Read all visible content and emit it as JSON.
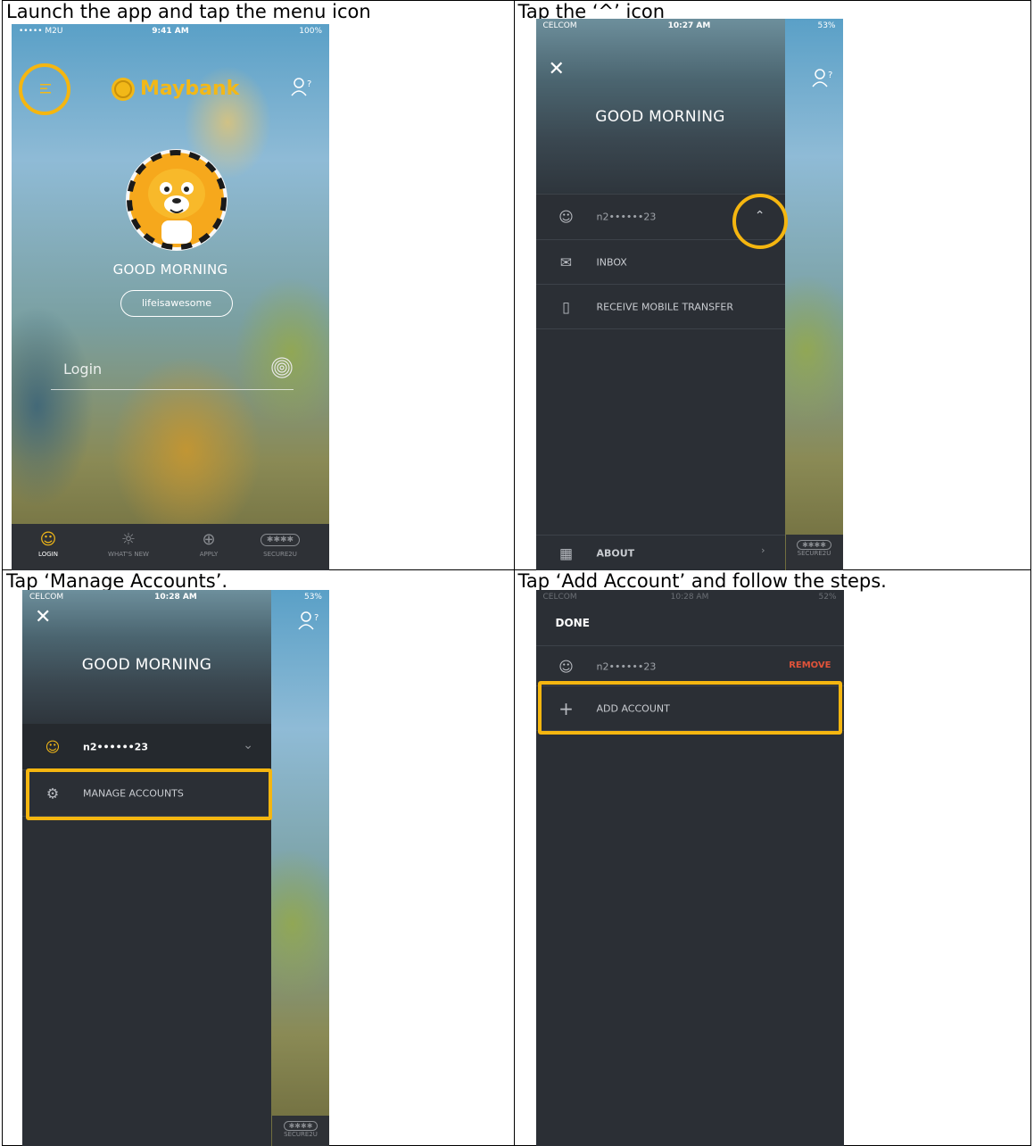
{
  "steps": [
    {
      "caption": "Launch the app and tap the menu icon",
      "status": {
        "carrier": "••••• M2U",
        "time": "9:41 AM",
        "battery": "100%"
      },
      "brand": "Maybank",
      "greeting": "GOOD MORNING",
      "username_pill": "lifeisawesome",
      "login_placeholder": "Login",
      "tabs": [
        {
          "label": "LOGIN",
          "icon": "user-icon"
        },
        {
          "label": "WHAT'S NEW",
          "icon": "lightbulb-icon"
        },
        {
          "label": "APPLY",
          "icon": "plus-circle-icon"
        },
        {
          "label": "SECURE2U",
          "icon": "secure2u-icon"
        }
      ]
    },
    {
      "caption": "Tap the ‘^’ icon",
      "status": {
        "carrier": "CELCOM",
        "time": "10:27 AM",
        "battery": "53%"
      },
      "greeting": "GOOD MORNING",
      "account": "n2••••••23",
      "menu": [
        {
          "label": "INBOX",
          "icon": "envelope-icon"
        },
        {
          "label": "RECEIVE MOBILE TRANSFER",
          "icon": "mobile-transfer-icon"
        }
      ],
      "about": "ABOUT",
      "secure_peek": "SECURE2U"
    },
    {
      "caption": "Tap ‘Manage Accounts’.",
      "status": {
        "carrier": "CELCOM",
        "time": "10:28 AM",
        "battery": "53%"
      },
      "greeting": "GOOD MORNING",
      "account": "n2••••••23",
      "manage": "MANAGE ACCOUNTS",
      "secure_peek": "SECURE2U"
    },
    {
      "caption": "Tap ‘Add Account’ and follow the steps.",
      "status": {
        "carrier": "CELCOM",
        "time": "10:28 AM",
        "battery": "52%"
      },
      "done": "DONE",
      "account": "n2••••••23",
      "remove": "REMOVE",
      "add": "ADD ACCOUNT"
    }
  ],
  "colors": {
    "accent": "#f5b610",
    "remove": "#e0533a",
    "drawer": "#2b2f35"
  }
}
